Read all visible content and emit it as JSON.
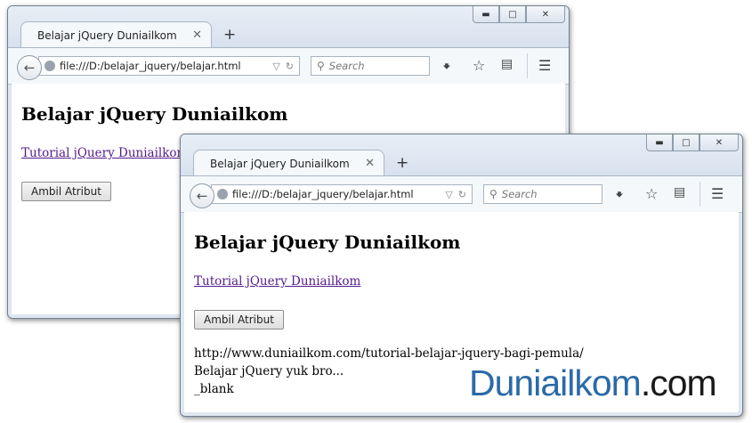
{
  "windows": [
    {
      "tab_title": "Belajar jQuery Duniailkom",
      "url": "file:///D:/belajar_jquery/belajar.html",
      "search_placeholder": "Search",
      "page": {
        "heading": "Belajar jQuery Duniailkom",
        "link_text": "Tutorial jQuery Duniailkom",
        "button_label": "Ambil Atribut",
        "output": []
      }
    },
    {
      "tab_title": "Belajar jQuery Duniailkom",
      "url": "file:///D:/belajar_jquery/belajar.html",
      "search_placeholder": "Search",
      "page": {
        "heading": "Belajar jQuery Duniailkom",
        "link_text": "Tutorial jQuery Duniailkom",
        "button_label": "Ambil Atribut",
        "output": [
          "http://www.duniailkom.com/tutorial-belajar-jquery-bagi-pemula/",
          "Belajar jQuery yuk bro...",
          "_blank"
        ]
      }
    }
  ],
  "watermark": {
    "part1": "Duniailkom",
    "part2": ".com",
    "accent_color": "#2b6aa8"
  },
  "icons": [
    "back-arrow-icon",
    "globe-icon",
    "dropdown-icon",
    "reload-icon",
    "search-icon",
    "download-icon",
    "star-icon",
    "reading-list-icon",
    "menu-icon",
    "close-tab-icon",
    "new-tab-icon",
    "minimize-icon",
    "maximize-icon",
    "close-window-icon"
  ]
}
